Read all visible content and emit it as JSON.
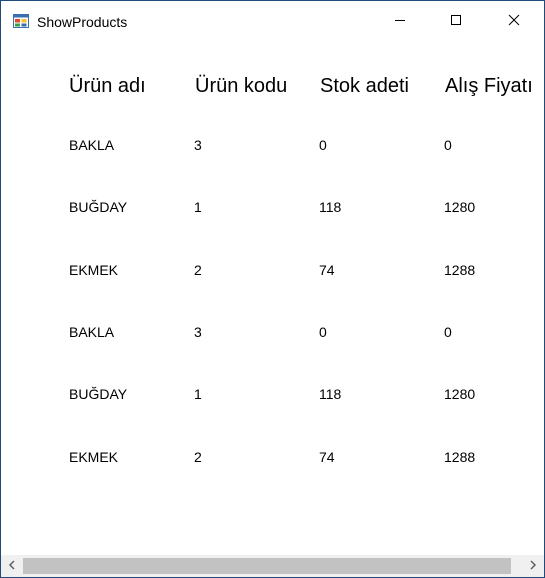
{
  "window": {
    "title": "ShowProducts",
    "app_icon": "windows-forms-icon",
    "controls": [
      "minimize-icon",
      "maximize-icon",
      "close-icon"
    ]
  },
  "table": {
    "headers": [
      "Ürün adı",
      "Ürün kodu",
      "Stok adeti",
      "Alış Fiyatı"
    ],
    "rows": [
      [
        "BAKLA",
        "3",
        "0",
        "0"
      ],
      [
        "BUĞDAY",
        "1",
        "118",
        "1280"
      ],
      [
        "EKMEK",
        "2",
        "74",
        "1288"
      ],
      [
        "BAKLA",
        "3",
        "0",
        "0"
      ],
      [
        "BUĞDAY",
        "1",
        "118",
        "1280"
      ],
      [
        "EKMEK",
        "2",
        "74",
        "1288"
      ]
    ]
  },
  "scrollbar": {
    "orientation": "horizontal",
    "left_icon": "chevron-left-icon",
    "right_icon": "chevron-right-icon"
  }
}
